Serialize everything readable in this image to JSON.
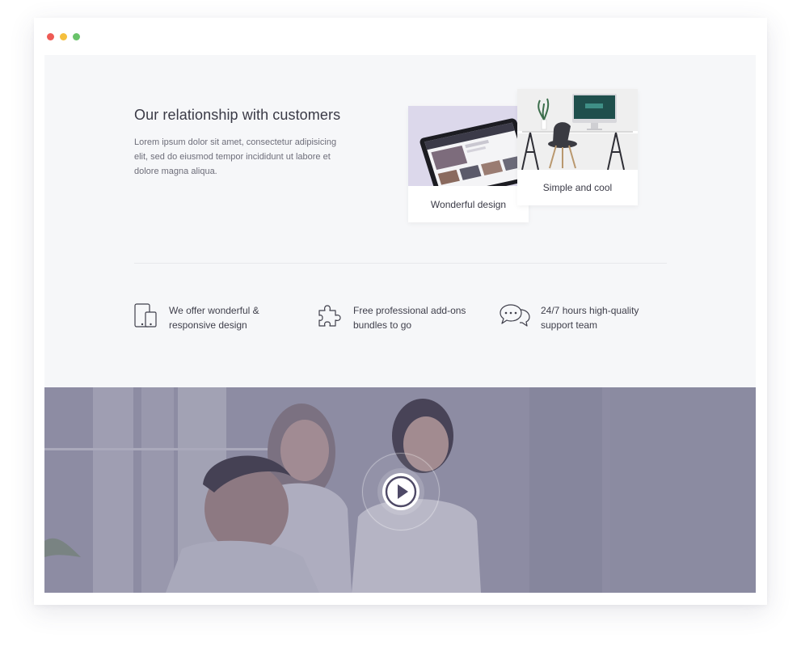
{
  "window": {
    "controls": [
      {
        "name": "close",
        "color": "#ee5b55"
      },
      {
        "name": "minimize",
        "color": "#f5bf3c"
      },
      {
        "name": "maximize",
        "color": "#69c36a"
      }
    ]
  },
  "relationship": {
    "title": "Our relationship with customers",
    "description": "Lorem ipsum dolor sit amet, consectetur adipisicing elit, sed do eiusmod tempor incididunt ut labore et dolore magna aliqua."
  },
  "cards": [
    {
      "label": "Wonderful design",
      "image": "tablet-mockup"
    },
    {
      "label": "Simple and cool",
      "image": "desk-with-imac-and-chair"
    }
  ],
  "features": [
    {
      "icon": "devices-icon",
      "text_line1": "We offer wonderful &",
      "text_line2": "responsive design"
    },
    {
      "icon": "puzzle-icon",
      "text_line1": "Free professional add-ons",
      "text_line2": "bundles to go"
    },
    {
      "icon": "chat-bubbles-icon",
      "text_line1": "24/7 hours high-quality",
      "text_line2": "support team"
    }
  ],
  "video": {
    "overlay_color": "#5a587c",
    "play_icon": "play-icon"
  }
}
